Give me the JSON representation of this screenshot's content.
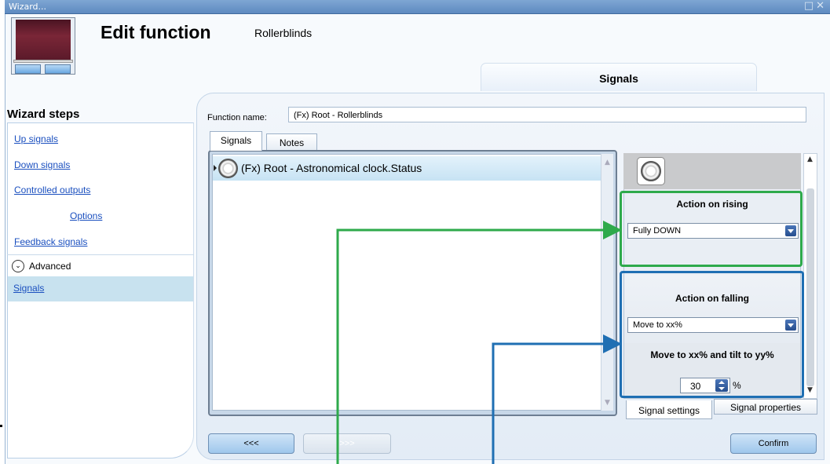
{
  "window": {
    "title": "Wizard..."
  },
  "header": {
    "title": "Edit function",
    "subject": "Rollerblinds",
    "active_tab": "Signals"
  },
  "wizard": {
    "title": "Wizard steps",
    "steps": [
      "Up signals",
      "Down signals",
      "Controlled outputs",
      "Options",
      "Feedback signals"
    ],
    "advanced_label": "Advanced",
    "selected_step": "Signals"
  },
  "form": {
    "function_name_label": "Function name:",
    "function_name_value": "(Fx) Root - Rollerblinds"
  },
  "tabs": [
    "Signals",
    "Notes"
  ],
  "signal_list": {
    "items": [
      "(Fx) Root - Astronomical clock.Status"
    ]
  },
  "settings": {
    "rising": {
      "title": "Action on rising",
      "value": "Fully DOWN"
    },
    "falling": {
      "title": "Action on falling",
      "value": "Move to xx%",
      "sub_title": "Move to xx% and tilt to yy%",
      "percent_value": "30",
      "unit": "%"
    },
    "bottom_tabs": [
      "Signal settings",
      "Signal properties"
    ]
  },
  "buttons": {
    "prev": "<<<",
    "next": ">>>",
    "confirm": "Confirm"
  },
  "colors": {
    "rising_highlight": "#2eaa4b",
    "falling_highlight": "#1f6fb3",
    "title_bar": "#6d97c9"
  }
}
